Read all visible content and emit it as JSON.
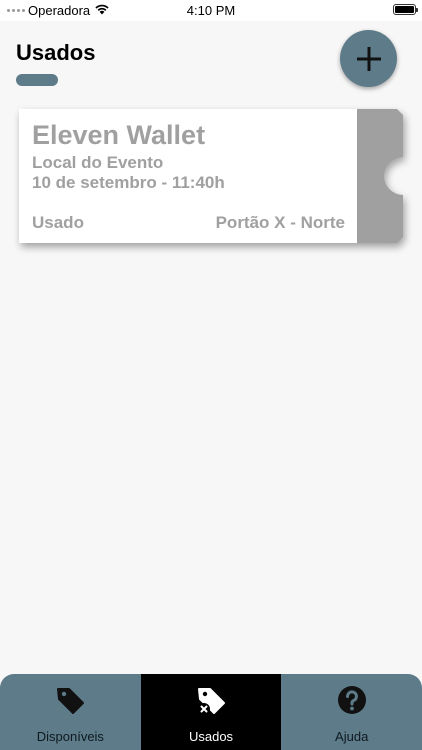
{
  "status_bar": {
    "carrier": "Operadora",
    "time": "4:10 PM",
    "battery_level": 1.0
  },
  "header": {
    "title": "Usados",
    "add_button_icon": "plus-icon"
  },
  "tickets": [
    {
      "event_name": "Eleven Wallet",
      "venue": "Local do Evento",
      "datetime": "10 de setembro - 11:40h",
      "status": "Usado",
      "gate": "Portão X - Norte"
    }
  ],
  "tabs": [
    {
      "label": "Disponíveis",
      "icon": "tag-icon",
      "active": false
    },
    {
      "label": "Usados",
      "icon": "tag-used-icon",
      "active": true
    },
    {
      "label": "Ajuda",
      "icon": "help-icon",
      "active": false
    }
  ],
  "colors": {
    "accent": "#5e7b89",
    "active_tab": "#000000",
    "ticket_text": "#a0a0a0",
    "ticket_stub": "#a0a0a0",
    "background": "#f7f7f7"
  }
}
